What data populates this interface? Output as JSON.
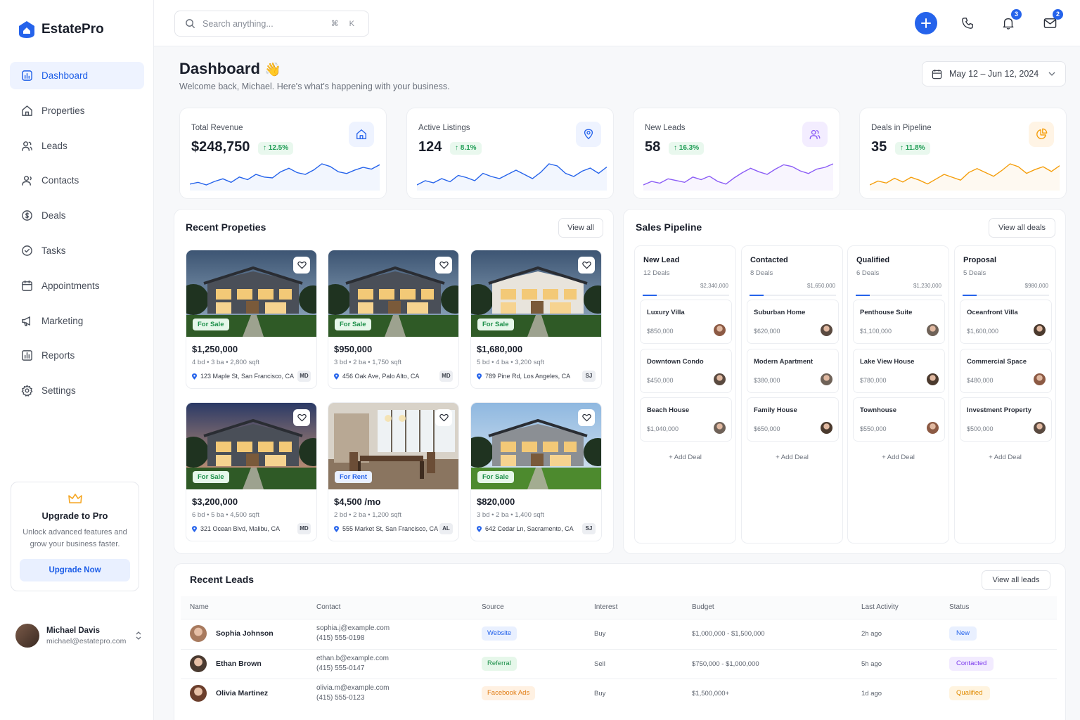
{
  "app": {
    "name": "EstatePro"
  },
  "nav": [
    {
      "label": "Dashboard",
      "icon": "dashboard-icon",
      "active": true
    },
    {
      "label": "Properties",
      "icon": "home-icon"
    },
    {
      "label": "Leads",
      "icon": "users-icon"
    },
    {
      "label": "Contacts",
      "icon": "contacts-icon"
    },
    {
      "label": "Deals",
      "icon": "dollar-icon"
    },
    {
      "label": "Tasks",
      "icon": "check-circle-icon"
    },
    {
      "label": "Appointments",
      "icon": "calendar-icon"
    },
    {
      "label": "Marketing",
      "icon": "megaphone-icon"
    },
    {
      "label": "Reports",
      "icon": "bar-chart-icon"
    },
    {
      "label": "Settings",
      "icon": "gear-icon"
    }
  ],
  "upgrade": {
    "title": "Upgrade to Pro",
    "text": "Unlock advanced features and grow your business faster.",
    "button": "Upgrade Now"
  },
  "user": {
    "name": "Michael Davis",
    "email": "michael@estatepro.com"
  },
  "topbar": {
    "search_placeholder": "Search anything...",
    "shortcut": "⌘ K",
    "notifications_count": "3",
    "messages_count": "2"
  },
  "header": {
    "title": "Dashboard",
    "emoji": "👋",
    "subtitle": "Welcome back, Michael. Here's what's happening with your business.",
    "date_range": "May 12 – Jun 12, 2024"
  },
  "kpis": [
    {
      "label": "Total Revenue",
      "value": "$248,750",
      "change": "12.5%",
      "color": "#2563eb",
      "icon": "house-icon",
      "spark": [
        22,
        24,
        21,
        25,
        28,
        24,
        30,
        27,
        33,
        30,
        29,
        36,
        40,
        35,
        33,
        38,
        45,
        42,
        36,
        34,
        38,
        41,
        39,
        44
      ]
    },
    {
      "label": "Active Listings",
      "value": "124",
      "change": "8.1%",
      "color": "#2563eb",
      "icon": "location-icon",
      "spark": [
        20,
        24,
        22,
        26,
        23,
        29,
        27,
        24,
        31,
        28,
        26,
        30,
        34,
        30,
        26,
        32,
        40,
        38,
        31,
        28,
        33,
        36,
        31,
        37
      ]
    },
    {
      "label": "New Leads",
      "value": "58",
      "change": "16.3%",
      "color": "#8b5cf6",
      "icon": "user-group-icon",
      "spark": [
        18,
        22,
        20,
        25,
        23,
        21,
        27,
        24,
        28,
        22,
        19,
        26,
        32,
        37,
        33,
        30,
        36,
        41,
        39,
        34,
        31,
        36,
        38,
        42
      ]
    },
    {
      "label": "Deals in Pipeline",
      "value": "35",
      "change": "11.8%",
      "color": "#f59e0b",
      "icon": "pie-icon",
      "spark": [
        16,
        20,
        18,
        23,
        19,
        24,
        21,
        17,
        22,
        27,
        24,
        21,
        29,
        33,
        29,
        25,
        31,
        38,
        35,
        28,
        32,
        35,
        30,
        36
      ]
    }
  ],
  "recent_properties": {
    "title": "Recent Propeties",
    "view_all": "View all",
    "items": [
      {
        "price": "$1,250,000",
        "specs": "4 bd • 3 ba • 2,800 sqft",
        "address": "123 Maple St, San Francisco, CA",
        "agent": "MD",
        "tag": "For Sale",
        "type": "sale",
        "scene": "modern"
      },
      {
        "price": "$950,000",
        "specs": "3 bd • 2 ba • 1,750 sqft",
        "address": "456 Oak Ave, Palo Alto, CA",
        "agent": "MD",
        "tag": "For Sale",
        "type": "sale",
        "scene": "modern2"
      },
      {
        "price": "$1,680,000",
        "specs": "5 bd • 4 ba • 3,200 sqft",
        "address": "789 Pine Rd, Los Angeles, CA",
        "agent": "SJ",
        "tag": "For Sale",
        "type": "sale",
        "scene": "classic"
      },
      {
        "price": "$3,200,000",
        "specs": "6 bd • 5 ba • 4,500 sqft",
        "address": "321 Ocean Blvd, Malibu, CA",
        "agent": "MD",
        "tag": "For Sale",
        "type": "sale",
        "scene": "dusk"
      },
      {
        "price": "$4,500 /mo",
        "specs": "2 bd • 2 ba • 1,200 sqft",
        "address": "555 Market St, San Francisco, CA",
        "agent": "AL",
        "tag": "For Rent",
        "type": "rent",
        "scene": "interior"
      },
      {
        "price": "$820,000",
        "specs": "3 bd • 2 ba • 1,400 sqft",
        "address": "642 Cedar Ln, Sacramento, CA",
        "agent": "SJ",
        "tag": "For Sale",
        "type": "sale",
        "scene": "day"
      }
    ]
  },
  "pipeline": {
    "title": "Sales Pipeline",
    "view_all": "View all deals",
    "add_label": "Add Deal",
    "columns": [
      {
        "name": "New Lead",
        "count": "12 Deals",
        "total": "$2,340,000",
        "deals": [
          {
            "name": "Luxury Villa",
            "price": "$850,000"
          },
          {
            "name": "Downtown Condo",
            "price": "$450,000"
          },
          {
            "name": "Beach House",
            "price": "$1,040,000"
          }
        ]
      },
      {
        "name": "Contacted",
        "count": "8 Deals",
        "total": "$1,650,000",
        "deals": [
          {
            "name": "Suburban Home",
            "price": "$620,000"
          },
          {
            "name": "Modern Apartment",
            "price": "$380,000"
          },
          {
            "name": "Family House",
            "price": "$650,000"
          }
        ]
      },
      {
        "name": "Qualified",
        "count": "6 Deals",
        "total": "$1,230,000",
        "deals": [
          {
            "name": "Penthouse Suite",
            "price": "$1,100,000"
          },
          {
            "name": "Lake View House",
            "price": "$780,000"
          },
          {
            "name": "Townhouse",
            "price": "$550,000"
          }
        ]
      },
      {
        "name": "Proposal",
        "count": "5 Deals",
        "total": "$980,000",
        "deals": [
          {
            "name": "Oceanfront Villa",
            "price": "$1,600,000"
          },
          {
            "name": "Commercial Space",
            "price": "$480,000"
          },
          {
            "name": "Investment Property",
            "price": "$500,000"
          }
        ]
      }
    ]
  },
  "leads": {
    "title": "Recent Leads",
    "view_all": "View all leads",
    "columns": [
      "Name",
      "Contact",
      "Source",
      "Interest",
      "Budget",
      "Last Activity",
      "Status"
    ],
    "rows": [
      {
        "name": "Sophia Johnson",
        "email": "sophia.j@example.com",
        "phone": "(415) 555-0198",
        "source": "Website",
        "interest": "Buy",
        "budget": "$1,000,000 - $1,500,000",
        "activity": "2h ago",
        "status": "New"
      },
      {
        "name": "Ethan Brown",
        "email": "ethan.b@example.com",
        "phone": "(415) 555-0147",
        "source": "Referral",
        "interest": "Sell",
        "budget": "$750,000 - $1,000,000",
        "activity": "5h ago",
        "status": "Contacted"
      },
      {
        "name": "Olivia Martinez",
        "email": "olivia.m@example.com",
        "phone": "(415) 555-0123",
        "source": "Facebook Ads",
        "interest": "Buy",
        "budget": "$1,500,000+",
        "activity": "1d ago",
        "status": "Qualified"
      }
    ]
  }
}
